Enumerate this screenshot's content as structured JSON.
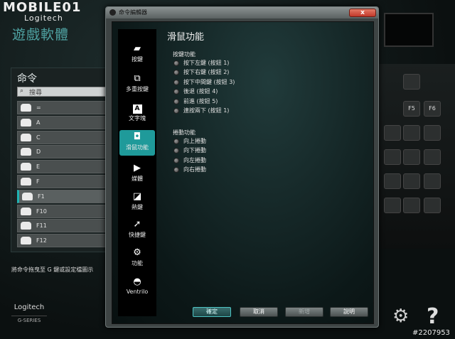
{
  "watermark": {
    "brand": "MOBILE01",
    "sub": "Logitech"
  },
  "photo_id": "#2207953",
  "app": {
    "title": "遊戲軟體",
    "panel_title": "命令",
    "search_placeholder": "搜尋",
    "commands": [
      "=",
      "A",
      "C",
      "D",
      "E",
      "F",
      "F1",
      "F10",
      "F11",
      "F12"
    ],
    "hint": "將命令拖曳至 G 鍵或設定檔圖示",
    "logo": "Logitech",
    "series": "G-SERIES",
    "help": "?",
    "keys": [
      "F5",
      "F6"
    ]
  },
  "dialog": {
    "title": "命令編輯器",
    "close": "x",
    "sidebar": [
      {
        "label": "按鍵",
        "icon": "key-icon"
      },
      {
        "label": "多重按鍵",
        "icon": "multikey-icon"
      },
      {
        "label": "文字塊",
        "icon": "text-block-icon",
        "glyph": "A"
      },
      {
        "label": "滑鼠功能",
        "icon": "mouse-icon"
      },
      {
        "label": "媒體",
        "icon": "play-icon"
      },
      {
        "label": "熱鍵",
        "icon": "hotkey-icon"
      },
      {
        "label": "快捷鍵",
        "icon": "shortcut-arrow-icon"
      },
      {
        "label": "功能",
        "icon": "gear-icon"
      },
      {
        "label": "Ventrilo",
        "icon": "headset-icon"
      }
    ],
    "heading": "滑鼠功能",
    "button_group": {
      "label": "按鍵功能",
      "options": [
        "按下左鍵 (按鈕 1)",
        "按下右鍵 (按鈕 2)",
        "按下中間鍵 (按鈕 3)",
        "後退 (按鈕 4)",
        "前進 (按鈕 5)",
        "連按兩下 (按鈕 1)"
      ]
    },
    "scroll_group": {
      "label": "捲動功能",
      "options": [
        "向上捲動",
        "向下捲動",
        "向左捲動",
        "向右捲動"
      ]
    },
    "buttons": {
      "ok": "確定",
      "cancel": "取消",
      "new": "新增",
      "help": "說明"
    }
  }
}
